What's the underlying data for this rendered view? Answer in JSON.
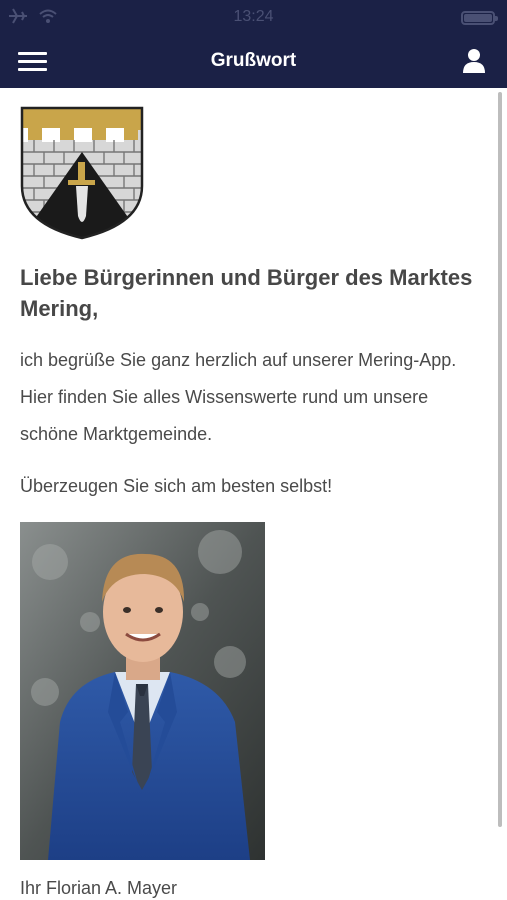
{
  "status_bar": {
    "time": "13:24",
    "icons": [
      "airplane-icon",
      "wifi-icon",
      "battery-icon"
    ]
  },
  "header": {
    "title": "Grußwort",
    "menu_icon": "hamburger-menu-icon",
    "profile_icon": "user-icon",
    "background": "#1b2146"
  },
  "main": {
    "crest_icon": "coat-of-arms-icon",
    "greeting": "Liebe Bürgerinnen und Bürger des Marktes Mering,",
    "intro": "ich begrüße Sie ganz herzlich auf unserer Mering-App. Hier finden Sie alles Wissenswerte rund um unsere schöne Marktgemeinde.",
    "call_to_action": "Überzeugen Sie sich am besten selbst!",
    "portrait_icon": "portrait-photo",
    "signature": "Ihr Florian A. Mayer"
  }
}
